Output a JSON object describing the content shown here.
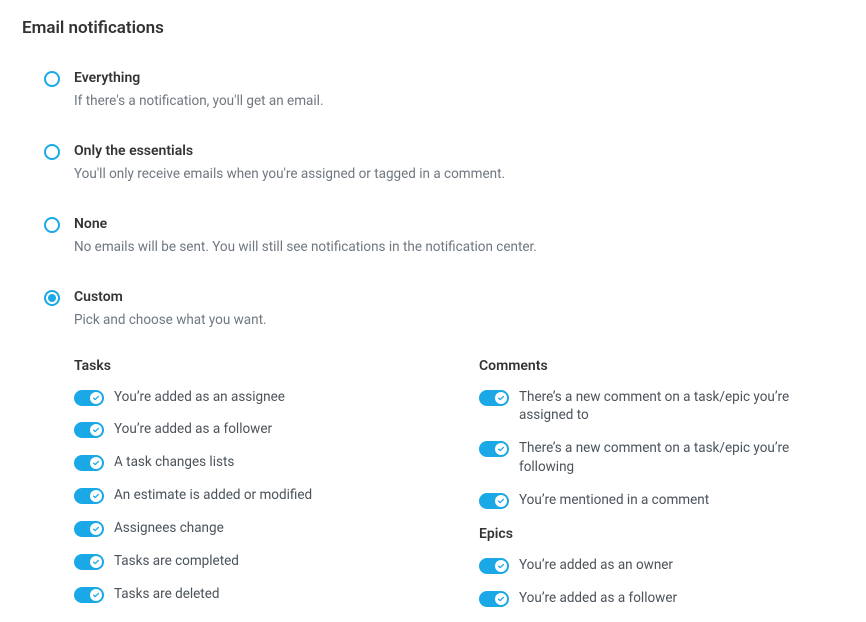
{
  "page_title": "Email notifications",
  "options": [
    {
      "key": "everything",
      "title": "Everything",
      "desc": "If there's a notification, you'll get an email.",
      "selected": false
    },
    {
      "key": "essentials",
      "title": "Only the essentials",
      "desc": "You'll only receive emails when you're assigned or tagged in a comment.",
      "selected": false
    },
    {
      "key": "none",
      "title": "None",
      "desc": "No emails will be sent. You will still see notifications in the notification center.",
      "selected": false
    },
    {
      "key": "custom",
      "title": "Custom",
      "desc": "Pick and choose what you want.",
      "selected": true
    }
  ],
  "custom": {
    "tasks_heading": "Tasks",
    "tasks": [
      {
        "label": "You’re added as an assignee",
        "on": true
      },
      {
        "label": "You’re added as a follower",
        "on": true
      },
      {
        "label": "A task changes lists",
        "on": true
      },
      {
        "label": "An estimate is added or modified",
        "on": true
      },
      {
        "label": "Assignees change",
        "on": true
      },
      {
        "label": "Tasks are completed",
        "on": true
      },
      {
        "label": "Tasks are deleted",
        "on": true
      }
    ],
    "comments_heading": "Comments",
    "comments": [
      {
        "label": "There’s a new comment on a task/epic you’re assigned to",
        "on": true
      },
      {
        "label": "There’s a new comment on a task/epic you’re following",
        "on": true
      },
      {
        "label": "You’re mentioned in a comment",
        "on": true
      }
    ],
    "epics_heading": "Epics",
    "epics": [
      {
        "label": "You’re added as an owner",
        "on": true
      },
      {
        "label": "You’re added as a follower",
        "on": true
      }
    ]
  }
}
